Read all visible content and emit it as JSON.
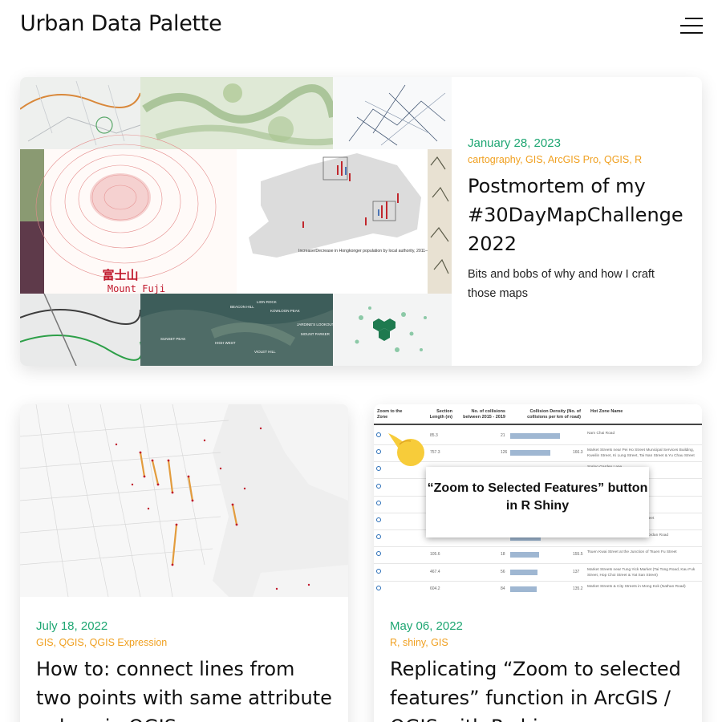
{
  "site": {
    "title": "Urban Data Palette",
    "menu_icon": "hamburger-menu-icon"
  },
  "posts": [
    {
      "date": "January 28, 2023",
      "tags": "cartography, GIS, ArcGIS Pro, QGIS, R",
      "title": "Postmortem of my #30DayMapChallenge 2022",
      "excerpt": "Bits and bobs of why and how I craft those maps",
      "thumbnail": {
        "fuji_cn": "富士山",
        "fuji_en": "Mount Fuji",
        "map_caption": "Increase/Decrease in Hongkonger population by local authority, 2011–2021",
        "peaks": [
          "BEACON HILL",
          "LION ROCK",
          "KOWLOON PEAK",
          "HIGH WEST",
          "SUNSET PEAK",
          "JARDINE'S LOOKOUT",
          "MOUNT PARKER",
          "VIOLET HILL"
        ]
      }
    },
    {
      "date": "July 18, 2022",
      "tags": "GIS, QGIS, QGIS Expression",
      "title": "How to: connect lines from two points with same attribute values in QGIS"
    },
    {
      "date": "May 06, 2022",
      "tags": "R, shiny, GIS",
      "title": "Replicating “Zoom to selected features” function in ArcGIS / QGIS with R shiny",
      "thumbnail": {
        "callout": "“Zoom to Selected Features” button in R Shiny",
        "headers": [
          "Zoom to the Zone",
          "Section Length (m)",
          "No. of collisions between 2015 - 2019",
          "Collision Density (No. of collisions per km of road)",
          "Hot Zone Name"
        ],
        "rows": [
          {
            "length": "85.3",
            "count": "21",
            "density": "",
            "bar": 0.62,
            "street": "Nam Chai Road"
          },
          {
            "length": "757.3",
            "count": "126",
            "density": "166.3",
            "bar": 0.5,
            "street": "Market Streets near Pei Ho Street Municipal Services Building, Kweilin Street, Ki Lung Street, Tai Nan Street & Yu Chau Street"
          },
          {
            "length": "",
            "count": "",
            "density": "",
            "bar": 0.45,
            "street": "Spring Garden Lane"
          },
          {
            "length": "",
            "count": "",
            "density": "",
            "bar": 0.4,
            "street": "Street"
          },
          {
            "length": "",
            "count": "",
            "density": "",
            "bar": 0.4,
            "street": "Market (Chuen Lung Street)"
          },
          {
            "length": "",
            "count": "",
            "density": "",
            "bar": 0.4,
            "street": "Municipal Services Building, Yan Street"
          },
          {
            "length": "",
            "count": "",
            "density": "",
            "bar": 0.38,
            "street": "Shanghai Street at the Junction of Jordan Road"
          },
          {
            "length": "105.6",
            "count": "18",
            "density": "155.5",
            "bar": 0.36,
            "street": "Tsuen Kwai Street at the Junction of Tsuen Fu Street"
          },
          {
            "length": "467.4",
            "count": "56",
            "density": "137",
            "bar": 0.34,
            "street": "Market Streets near Tung Yick Market (Tai Tong Road, Kau Fuk Street, Hop Choi Street & Yat San Street)"
          },
          {
            "length": "604.2",
            "count": "84",
            "density": "135.2",
            "bar": 0.33,
            "street": "Market Streets & City Streets in Mong Kok (Nathan Road)"
          }
        ]
      }
    }
  ]
}
